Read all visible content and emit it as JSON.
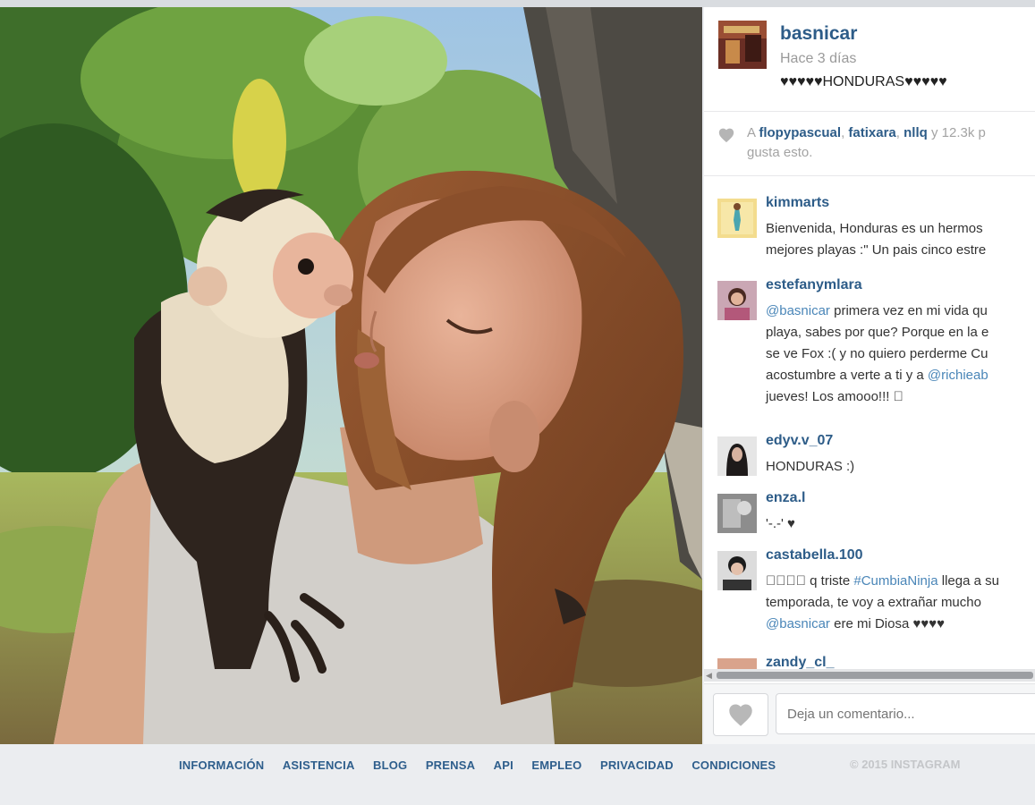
{
  "post": {
    "username": "basnicar",
    "time": "Hace 3 días",
    "caption": "♥♥♥♥♥HONDURAS♥♥♥♥♥"
  },
  "likes": {
    "prefix": "A ",
    "users": [
      "flopypascual",
      "fatixara",
      "nllq"
    ],
    "sep1": ", ",
    "sep2": ", ",
    "suffix": " y 12.3k p",
    "line2": "gusta esto."
  },
  "comments": [
    {
      "user": "kimmarts",
      "lines": [
        "Bienvenida, Honduras es un hermos",
        "mejores playas :\" Un pais cinco estre"
      ]
    },
    {
      "user": "estefanymlara",
      "lines": [
        "@basnicar primera vez en mi vida qu",
        "playa, sabes por que? Porque en la e",
        "se ve Fox :( y no quiero perderme Cu",
        "acostumbre a verte a ti y a @richieab",
        "jueves! Los amooo!!! 󾌴"
      ]
    },
    {
      "user": "edyv.v_07",
      "lines": [
        "HONDURAS :)"
      ]
    },
    {
      "user": "enza.l",
      "lines": [
        "'-.-' ♥"
      ]
    },
    {
      "user": "castabella.100",
      "lines": [
        "󾌴󾌴󾌴󾌴 q triste #CumbiaNinja llega a su",
        "temporada, te voy a extrañar mucho",
        "@basnicar ere mi Diosa ♥♥♥♥"
      ]
    },
    {
      "user": "zandy_cl_",
      "lines": []
    }
  ],
  "comment_box": {
    "placeholder": "Deja un comentario..."
  },
  "footer": {
    "links": [
      "INFORMACIÓN",
      "ASISTENCIA",
      "BLOG",
      "PRENSA",
      "API",
      "EMPLEO",
      "PRIVACIDAD",
      "CONDICIONES"
    ],
    "copyright": "© 2015 INSTAGRAM"
  },
  "colors": {
    "link": "#2d5c88",
    "mention": "#4a86b8",
    "muted": "#9a9a9a"
  },
  "icons": [
    "heart-icon",
    "like-heart-icon",
    "scroll-left-arrow-icon"
  ]
}
